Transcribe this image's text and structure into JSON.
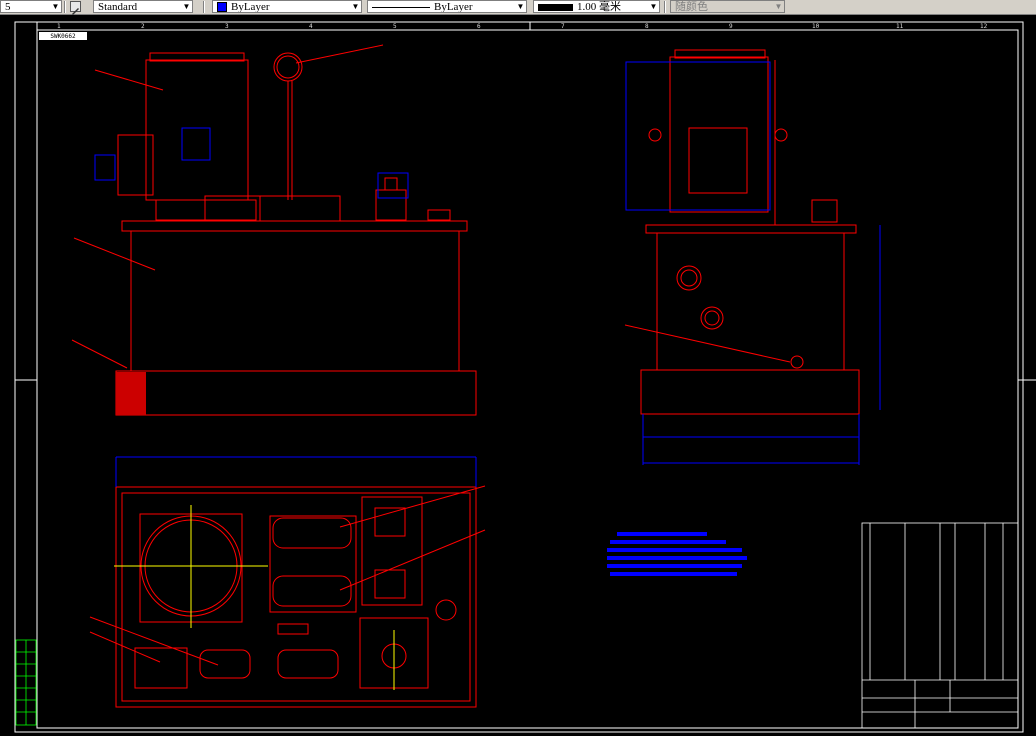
{
  "toolbar": {
    "scale_value": "5",
    "text_style": "Standard",
    "layer": "ByLayer",
    "linetype": "ByLayer",
    "lineweight": "1.00 毫米",
    "plot_style": "随颜色",
    "layer_color": "#0000ff"
  },
  "drawing": {
    "stamp_text": "SWK0662",
    "column_numbers": [
      "1",
      "2",
      "3",
      "4",
      "5",
      "6",
      "7",
      "8",
      "9",
      "10",
      "11",
      "12"
    ],
    "colors": {
      "background": "#000000",
      "frame": "#ffffff",
      "geometry": "#ff0000",
      "dimension": "#0000ff",
      "centerline": "#ffff00",
      "title_block": "#ffffff"
    }
  }
}
